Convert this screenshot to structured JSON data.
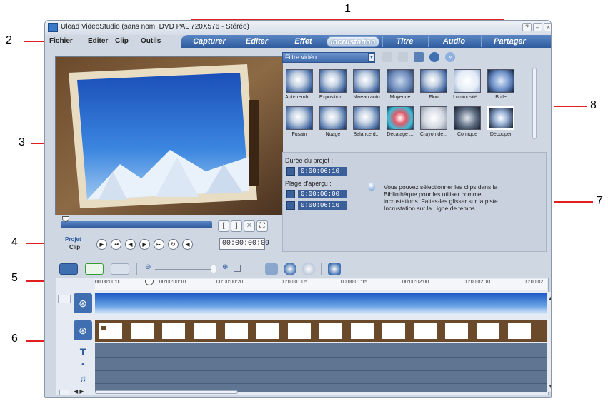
{
  "callouts": [
    "1",
    "2",
    "3",
    "4",
    "5",
    "6",
    "7",
    "8"
  ],
  "window": {
    "title": "Ulead VideoStudio (sans nom, DVD PAL 720X576 - Stéréo)",
    "buttons": [
      "?",
      "–",
      "×"
    ]
  },
  "menu": [
    "Fichier",
    "Editer",
    "Clip",
    "Outils"
  ],
  "tabs": [
    "Capturer",
    "Editer",
    "Effet",
    "Incrustation",
    "Titre",
    "Audio",
    "Partager"
  ],
  "active_tab": "Incrustation",
  "preview": {
    "mode_project": "Projet",
    "mode_clip": "Clip",
    "timecode": "00:00:00:09",
    "mark_in": "[",
    "mark_out": "]"
  },
  "library": {
    "filter": "Filtre vidéo",
    "filters_row1": [
      "Anti-trembl...",
      "Exposition...",
      "Niveau auto",
      "Moyenne",
      "Flou",
      "Luminosité...",
      "Bulle"
    ],
    "filters_row2": [
      "Fusain",
      "Nuage",
      "Balance d...",
      "Décalage ...",
      "Crayon de...",
      "Comique",
      "Découper"
    ]
  },
  "options": {
    "duration_label": "Durée du projet :",
    "duration_value": "0:00:06:10",
    "range_label": "Plage d'aperçu :",
    "range_start": "0:00:00:00",
    "range_end": "0:00:06:10",
    "info": "Vous pouvez sélectionner les clips dans la Bibliothèque pour les utiliser comme incrustations. Faites-les glisser sur la piste Incrustation sur la Ligne de temps."
  },
  "timeline": {
    "ruler": [
      "00:00:00:00",
      "00:00:00:10",
      "00:00:00:20",
      "00:00:01:05",
      "00:00:01:15",
      "00:00:02:00",
      "00:00:02:10",
      "00:00:02"
    ],
    "track_icons": [
      "video-track-icon",
      "overlay-track-icon",
      "title-track-icon",
      "voice-track-icon",
      "music-track-icon"
    ],
    "title_track_label": "T"
  },
  "colors": {
    "accent_blue": "#2f5c9e",
    "callout_red": "#e02020",
    "panel_bg": "#cfd7e3"
  }
}
